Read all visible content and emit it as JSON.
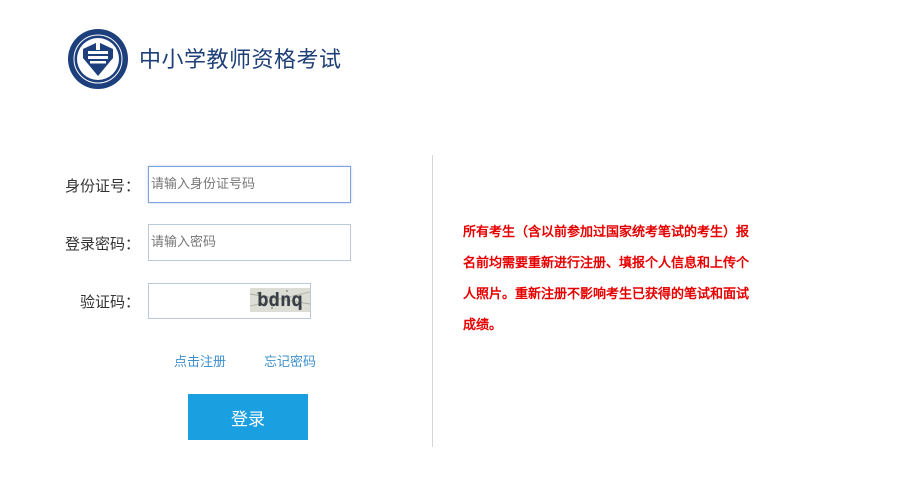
{
  "header": {
    "title": "中小学教师资格考试",
    "logo_icon": "teacher-exam-emblem-icon"
  },
  "form": {
    "id_label": "身份证号：",
    "id_placeholder": "请输入身份证号码",
    "id_value": "",
    "password_label": "登录密码：",
    "password_placeholder": "请输入密码",
    "password_value": "",
    "captcha_label": "验证码：",
    "captcha_value": "",
    "captcha_text": "bdnq",
    "register_link": "点击注册",
    "forgot_link": "忘记密码",
    "login_button": "登录"
  },
  "notice": {
    "text": "所有考生（含以前参加过国家统考笔试的考生）报名前均需要重新进行注册、填报个人信息和上传个人照片。重新注册不影响考生已获得的笔试和面试成绩。"
  },
  "colors": {
    "title": "#1e3f78",
    "accent": "#1a9fe0",
    "link": "#3d8fcd",
    "notice": "#e60000"
  }
}
